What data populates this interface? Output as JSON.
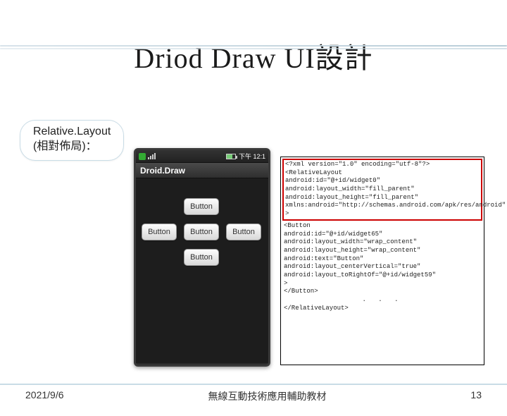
{
  "title_en": "Driod Draw UI",
  "title_cjk": "設計",
  "badge_line1": "Relative.Layout",
  "badge_line2": " (相對佈局)：",
  "statusbar_time": "下午 12:1",
  "app_header": "Droid.Draw",
  "button_label": "Button",
  "code": {
    "l1": "<?xml version=\"1.0\" encoding=\"utf-8\"?>",
    "l2": "<RelativeLayout",
    "l3": "android:id=\"@+id/widget0\"",
    "l4": "android:layout_width=\"fill_parent\"",
    "l5": "android:layout_height=\"fill_parent\"",
    "l6": "xmlns:android=\"http://schemas.android.com/apk/res/android\"",
    "l7": ">",
    "l8": "<Button",
    "l9": "android:id=\"@+id/widget65\"",
    "l10": "android:layout_width=\"wrap_content\"",
    "l11": "android:layout_height=\"wrap_content\"",
    "l12": "android:text=\"Button\"",
    "l13": "android:layout_centerVertical=\"true\"",
    "l14": "android:layout_toRightOf=\"@+id/widget59\"",
    "l15": ">",
    "l16": "</Button>",
    "dots": ". . .",
    "l17": "</RelativeLayout>"
  },
  "footer_date": "2021/9/6",
  "footer_center": "無線互動技術應用輔助教材",
  "footer_page": "13"
}
